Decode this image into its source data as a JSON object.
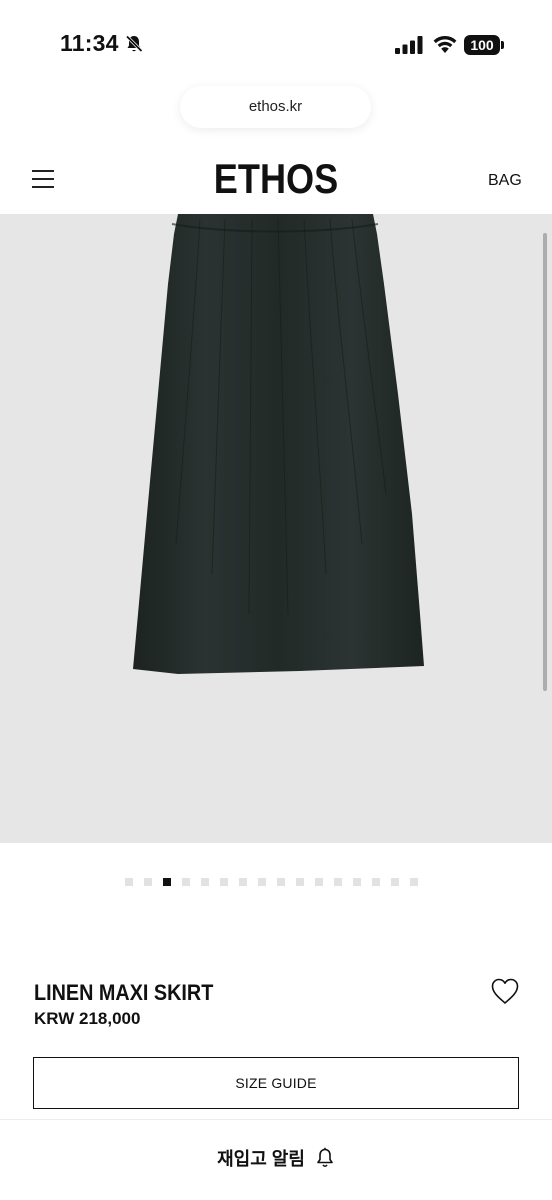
{
  "status_bar": {
    "time": "11:34",
    "battery": "100"
  },
  "browser": {
    "url": "ethos.kr"
  },
  "header": {
    "brand": "ETHOS",
    "bag_label": "BAG",
    "menu_icon": "hamburger-menu-icon"
  },
  "gallery": {
    "image_subject": "black linen maxi skirt",
    "background_color": "#e7e6e6",
    "total_slides": 16,
    "active_slide": 3
  },
  "product": {
    "name": "LINEN MAXI SKIRT",
    "price": "KRW 218,000",
    "size_guide_label": "SIZE GUIDE",
    "wishlist_icon": "heart-icon"
  },
  "bottom_bar": {
    "restock_label": "재입고 알림",
    "icon": "bell-icon"
  }
}
